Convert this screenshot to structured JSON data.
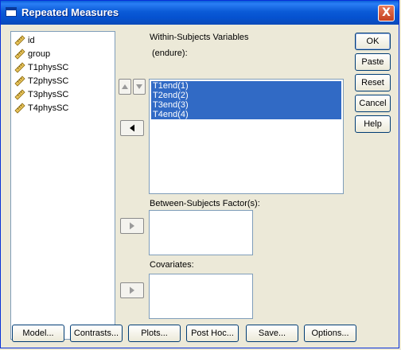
{
  "window": {
    "title": "Repeated Measures",
    "close_label": "X"
  },
  "variables": [
    {
      "name": "id",
      "icon": "scale-ruler-icon"
    },
    {
      "name": "group",
      "icon": "scale-ruler-icon"
    },
    {
      "name": "T1physSC",
      "icon": "scale-ruler-icon"
    },
    {
      "name": "T2physSC",
      "icon": "scale-ruler-icon"
    },
    {
      "name": "T3physSC",
      "icon": "scale-ruler-icon"
    },
    {
      "name": "T4physSC",
      "icon": "scale-ruler-icon"
    }
  ],
  "within": {
    "label": "Within-Subjects Variables",
    "factor": "(endure):",
    "items": [
      "T1end(1)",
      "T2end(2)",
      "T3end(3)",
      "T4end(4)"
    ]
  },
  "between": {
    "label": "Between-Subjects Factor(s):"
  },
  "covariates": {
    "label": "Covariates:"
  },
  "side_buttons": {
    "ok": "OK",
    "paste": "Paste",
    "reset": "Reset",
    "cancel": "Cancel",
    "help": "Help"
  },
  "bottom_buttons": {
    "model": "Model...",
    "contrasts": "Contrasts...",
    "plots": "Plots...",
    "posthoc": "Post Hoc...",
    "save": "Save...",
    "options": "Options..."
  },
  "colors": {
    "selection": "#316ac5",
    "titlebar": "#0a5fd8",
    "dialog_bg": "#ece9d8"
  }
}
